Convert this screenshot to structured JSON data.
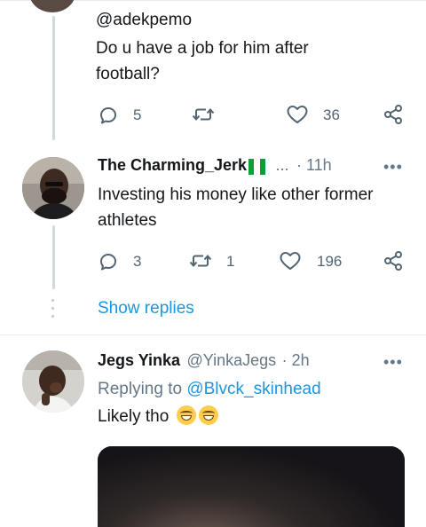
{
  "tweet1": {
    "mention": "@adekpemo",
    "text": "Do u have a job for him after football?",
    "replies": "5",
    "likes": "36"
  },
  "tweet2": {
    "name": "The Charming_Jerk",
    "ellipsis": "...",
    "time": "· 11h",
    "text": "Investing his money like other former athletes",
    "replies": "3",
    "retweets": "1",
    "likes": "196"
  },
  "show_replies": "Show replies",
  "tweet3": {
    "name": "Jegs Yinka",
    "handle": "@YinkaJegs",
    "time": "· 2h",
    "replying_prefix": "Replying to",
    "replying_to": "@Blvck_skinhead",
    "text": "Likely tho"
  },
  "icons": [
    "reply-icon",
    "retweet-icon",
    "like-icon",
    "share-icon",
    "more-icon"
  ],
  "colors": {
    "link": "#1b95e0",
    "secondary": "#657786",
    "thread_line": "#cfd9de"
  }
}
